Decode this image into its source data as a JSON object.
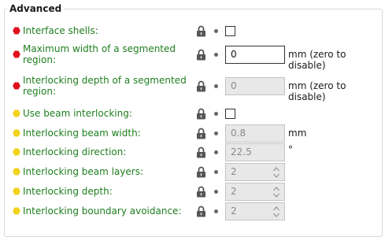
{
  "group": {
    "title": "Advanced"
  },
  "colors": {
    "red": "#e0101e",
    "yellow": "#f2d21b",
    "label": "#1e7e1e"
  },
  "rows": [
    {
      "label": "Interface shells:",
      "severity": "red",
      "control": "checkbox",
      "checked": false
    },
    {
      "label": "Maximum width of a segmented region:",
      "severity": "red",
      "control": "text",
      "value": "0",
      "enabled": true,
      "unit": "mm (zero to disable)"
    },
    {
      "label": "Interlocking depth of a segmented region:",
      "severity": "red",
      "control": "text",
      "value": "0",
      "enabled": false,
      "unit": "mm (zero to disable)"
    },
    {
      "label": "Use beam interlocking:",
      "severity": "yellow",
      "control": "checkbox",
      "checked": false
    },
    {
      "label": "Interlocking beam width:",
      "severity": "yellow",
      "control": "text",
      "value": "0.8",
      "enabled": false,
      "unit": "mm"
    },
    {
      "label": "Interlocking direction:",
      "severity": "yellow",
      "control": "text",
      "value": "22.5",
      "enabled": false,
      "unit": "°"
    },
    {
      "label": "Interlocking beam layers:",
      "severity": "yellow",
      "control": "spin",
      "value": "2",
      "enabled": false,
      "unit": ""
    },
    {
      "label": "Interlocking depth:",
      "severity": "yellow",
      "control": "spin",
      "value": "2",
      "enabled": false,
      "unit": ""
    },
    {
      "label": "Interlocking boundary avoidance:",
      "severity": "yellow",
      "control": "spin",
      "value": "2",
      "enabled": false,
      "unit": ""
    }
  ]
}
